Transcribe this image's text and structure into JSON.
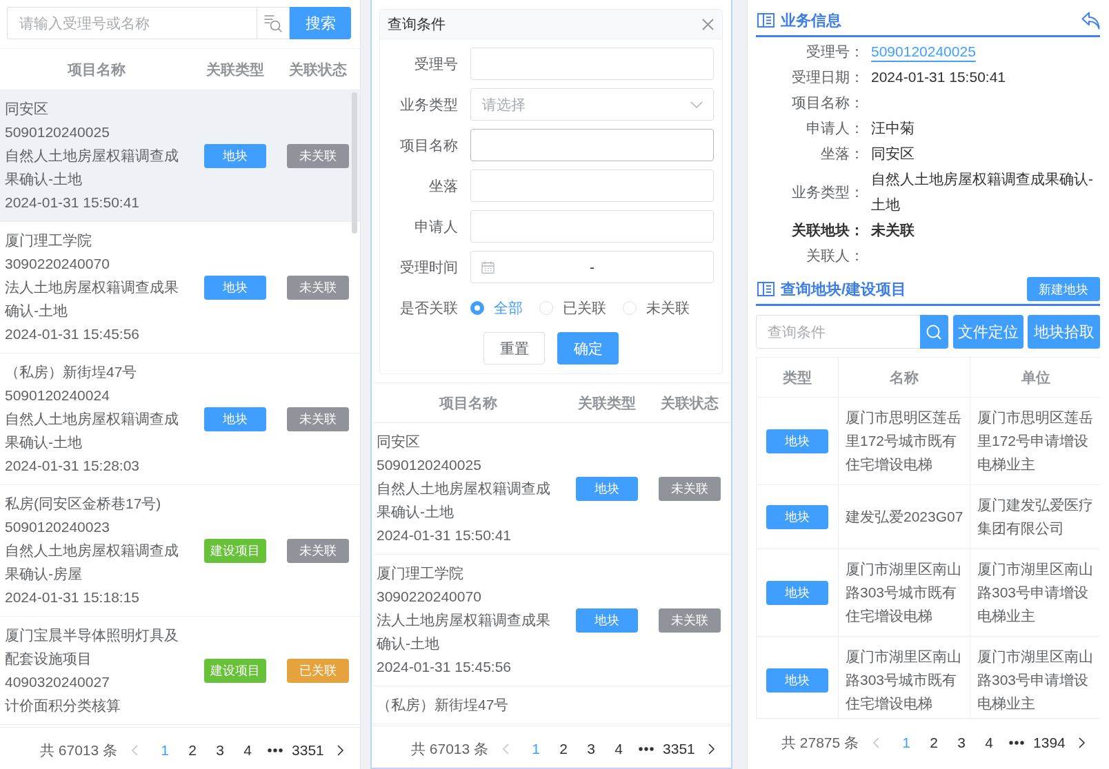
{
  "left_panel": {
    "search": {
      "placeholder": "请输入受理号或名称",
      "button": "搜索"
    },
    "columns": [
      "项目名称",
      "关联类型",
      "关联状态"
    ],
    "rows": [
      {
        "selected": true,
        "name": "同安区",
        "number": "5090120240025",
        "business_type": "自然人土地房屋权籍调查成果确认-土地",
        "date": "2024-01-31 15:50:41",
        "type": {
          "label": "地块",
          "color": "#409eff"
        },
        "status": {
          "label": "未关联",
          "color": "#909399"
        }
      },
      {
        "selected": false,
        "name": "厦门理工学院",
        "number": "3090220240070",
        "business_type": "法人土地房屋权籍调查成果确认-土地",
        "date": "2024-01-31 15:45:56",
        "type": {
          "label": "地块",
          "color": "#409eff"
        },
        "status": {
          "label": "未关联",
          "color": "#909399"
        }
      },
      {
        "selected": false,
        "name": "（私房）新街埕47号",
        "number": "5090120240024",
        "business_type": "自然人土地房屋权籍调查成果确认-土地",
        "date": "2024-01-31 15:28:03",
        "type": {
          "label": "地块",
          "color": "#409eff"
        },
        "status": {
          "label": "未关联",
          "color": "#909399"
        }
      },
      {
        "selected": false,
        "name": "私房(同安区金桥巷17号)",
        "number": "5090120240023",
        "business_type": "自然人土地房屋权籍调查成果确认-房屋",
        "date": "2024-01-31 15:18:15",
        "type": {
          "label": "建设项目",
          "color": "#67c23a"
        },
        "status": {
          "label": "未关联",
          "color": "#909399"
        }
      },
      {
        "selected": false,
        "name": "厦门宝晨半导体照明灯具及配套设施项目",
        "number": "4090320240027",
        "business_type": "计价面积分类核算",
        "type": {
          "label": "建设项目",
          "color": "#67c23a"
        },
        "status": {
          "label": "已关联",
          "color": "#e6a23c"
        }
      }
    ],
    "pagination": {
      "total": "共 67013 条",
      "prev": {
        "disabled": true
      },
      "pages": [
        {
          "label": "1",
          "selected": true
        },
        {
          "label": "2",
          "selected": false
        },
        {
          "label": "3",
          "selected": false
        },
        {
          "label": "4",
          "selected": false
        }
      ],
      "last_page": {
        "label": "3351",
        "selected": false
      },
      "next": {
        "disabled": false
      }
    }
  },
  "query_panel": {
    "form": {
      "title": "查询条件",
      "fields": [
        {
          "label": "受理号",
          "kind": "text",
          "hovered": false
        },
        {
          "label": "业务类型",
          "kind": "select",
          "placeholder": "请选择",
          "hovered": false
        },
        {
          "label": "项目名称",
          "kind": "text",
          "hovered": true
        },
        {
          "label": "坐落",
          "kind": "text",
          "hovered": false
        },
        {
          "label": "申请人",
          "kind": "text",
          "hovered": false
        },
        {
          "label": "受理时间",
          "kind": "daterange",
          "separator": "-",
          "hovered": false
        },
        {
          "label": "是否关联",
          "kind": "radio",
          "options": [
            {
              "label": "全部",
              "selected": true
            },
            {
              "label": "已关联",
              "selected": false
            },
            {
              "label": "未关联",
              "selected": false
            }
          ]
        }
      ],
      "buttons": [
        {
          "label": "重置",
          "kind": "default"
        },
        {
          "label": "确定",
          "kind": "primary"
        }
      ]
    },
    "columns": [
      "项目名称",
      "关联类型",
      "关联状态"
    ],
    "rows": [
      {
        "selected": false,
        "name": "同安区",
        "number": "5090120240025",
        "business_type": "自然人土地房屋权籍调查成果确认-土地",
        "date": "2024-01-31 15:50:41",
        "type": {
          "label": "地块",
          "color": "#409eff"
        },
        "status": {
          "label": "未关联",
          "color": "#909399"
        }
      },
      {
        "selected": false,
        "name": "厦门理工学院",
        "number": "3090220240070",
        "business_type": "法人土地房屋权籍调查成果确认-土地",
        "date": "2024-01-31 15:45:56",
        "type": {
          "label": "地块",
          "color": "#409eff"
        },
        "status": {
          "label": "未关联",
          "color": "#909399"
        }
      },
      {
        "selected": false,
        "name": "（私房）新街埕47号"
      }
    ],
    "pagination": {
      "total": "共 67013 条",
      "prev": {
        "disabled": true
      },
      "pages": [
        {
          "label": "1",
          "selected": true
        },
        {
          "label": "2",
          "selected": false
        },
        {
          "label": "3",
          "selected": false
        },
        {
          "label": "4",
          "selected": false
        }
      ],
      "last_page": {
        "label": "3351",
        "selected": false
      },
      "next": {
        "disabled": false
      }
    }
  },
  "detail_panel": {
    "business_info": {
      "title": "业务信息",
      "fields": [
        {
          "label": "受理号：",
          "value": "5090120240025",
          "kind": "link"
        },
        {
          "label": "受理日期：",
          "value": "2024-01-31 15:50:41",
          "kind": "text"
        },
        {
          "label": "项目名称：",
          "kind": "text"
        },
        {
          "label": "申请人：",
          "value": "汪中菊",
          "kind": "text"
        },
        {
          "label": "坐落：",
          "value": "同安区",
          "kind": "text"
        },
        {
          "label": "业务类型：",
          "value": "自然人土地房屋权籍调查成果确认-土地",
          "kind": "text"
        },
        {
          "label": "关联地块：",
          "value": "未关联",
          "kind": "strong"
        },
        {
          "label": "关联人：",
          "kind": "text"
        }
      ]
    },
    "parcel_search": {
      "title": "查询地块/建设项目",
      "new_button": "新建地块",
      "search": {
        "placeholder": "查询条件"
      },
      "buttons": [
        "文件定位",
        "地块拾取"
      ],
      "table": {
        "columns": [
          "类型",
          "名称",
          "单位"
        ],
        "rows": [
          {
            "type": {
              "label": "地块",
              "color": "#409eff"
            },
            "name": "厦门市思明区莲岳里172号城市既有住宅增设电梯",
            "unit": "厦门市思明区莲岳里172号申请增设电梯业主"
          },
          {
            "type": {
              "label": "地块",
              "color": "#409eff"
            },
            "name": "建发弘爱2023G07",
            "unit": "厦门建发弘爱医疗集团有限公司"
          },
          {
            "type": {
              "label": "地块",
              "color": "#409eff"
            },
            "name": "厦门市湖里区南山路303号城市既有住宅增设电梯",
            "unit": "厦门市湖里区南山路303号申请增设电梯业主"
          },
          {
            "type": {
              "label": "地块",
              "color": "#409eff"
            },
            "name": "厦门市湖里区南山路303号城市既有住宅增设电梯",
            "unit": "厦门市湖里区南山路303号申请增设电梯业主"
          }
        ]
      },
      "pagination": {
        "total": "共 27875 条",
        "prev": {
          "disabled": true
        },
        "pages": [
          {
            "label": "1",
            "selected": true
          },
          {
            "label": "2",
            "selected": false
          },
          {
            "label": "3",
            "selected": false
          },
          {
            "label": "4",
            "selected": false
          }
        ],
        "last_page": {
          "label": "1394",
          "selected": false
        },
        "next": {
          "disabled": false
        }
      }
    }
  }
}
